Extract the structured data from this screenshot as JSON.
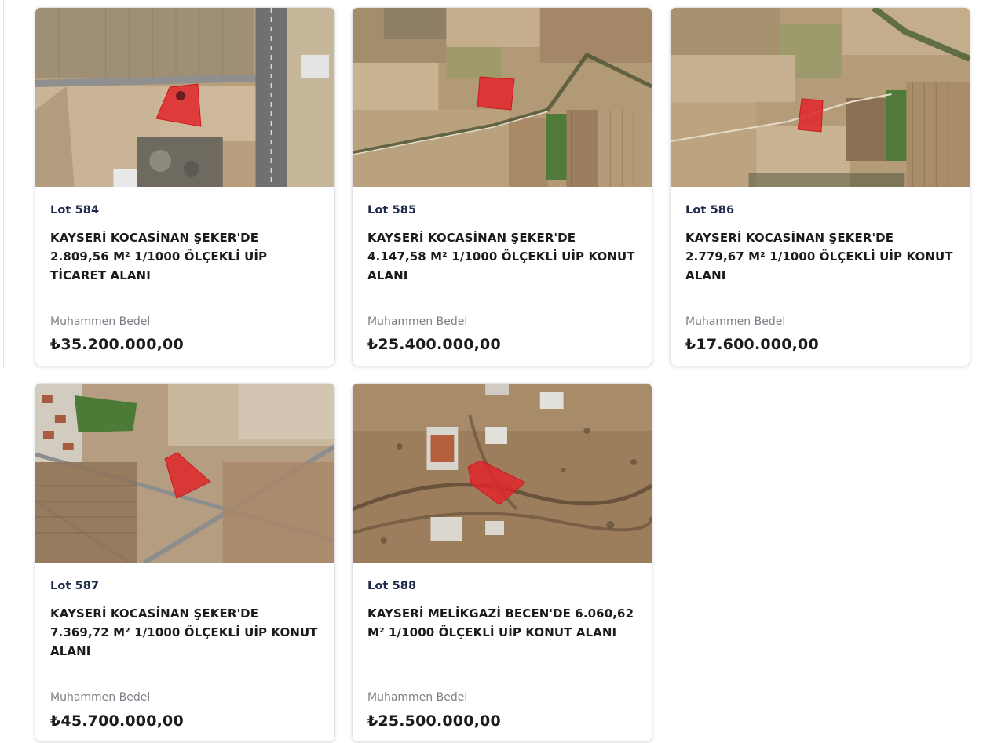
{
  "lots": [
    {
      "lot": "Lot 584",
      "title": "KAYSERİ KOCASİNAN ŞEKER'DE 2.809,56 M² 1/1000 ÖLÇEKLİ UİP TİCARET ALANI",
      "price_label": "Muhammen Bedel",
      "price": "₺35.200.000,00",
      "image": "satellite-parcel-map"
    },
    {
      "lot": "Lot 585",
      "title": "KAYSERİ KOCASİNAN ŞEKER'DE 4.147,58 M² 1/1000 ÖLÇEKLİ UİP KONUT ALANI",
      "price_label": "Muhammen Bedel",
      "price": "₺25.400.000,00",
      "image": "satellite-parcel-map"
    },
    {
      "lot": "Lot 586",
      "title": "KAYSERİ KOCASİNAN ŞEKER'DE 2.779,67 M² 1/1000 ÖLÇEKLİ UİP KONUT ALANI",
      "price_label": "Muhammen Bedel",
      "price": "₺17.600.000,00",
      "image": "satellite-parcel-map"
    },
    {
      "lot": "Lot 587",
      "title": "KAYSERİ KOCASİNAN ŞEKER'DE 7.369,72 M² 1/1000 ÖLÇEKLİ UİP KONUT ALANI",
      "price_label": "Muhammen Bedel",
      "price": "₺45.700.000,00",
      "image": "satellite-parcel-map"
    },
    {
      "lot": "Lot 588",
      "title": "KAYSERİ MELİKGAZİ BECEN'DE 6.060,62 M² 1/1000 ÖLÇEKLİ UİP KONUT ALANI",
      "price_label": "Muhammen Bedel",
      "price": "₺25.500.000,00",
      "image": "satellite-parcel-map"
    }
  ],
  "colors": {
    "lot_number": "#1f2a4d",
    "parcel_highlight": "#e0262a",
    "label": "#7b7f87"
  }
}
